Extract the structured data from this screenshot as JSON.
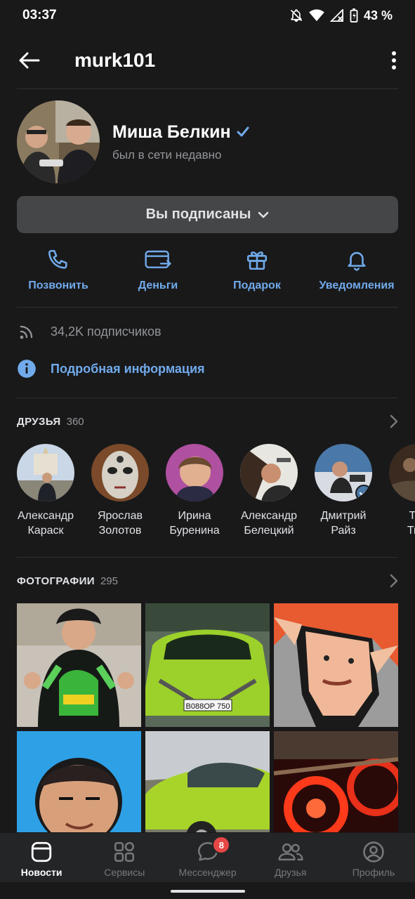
{
  "status_bar": {
    "time": "03:37",
    "battery": "43 %"
  },
  "header": {
    "title": "murk101"
  },
  "profile": {
    "name": "Миша Белкин",
    "status": "был в сети недавно",
    "subscribe_label": "Вы подписаны"
  },
  "actions": [
    {
      "label": "Позвонить",
      "icon": "phone-icon"
    },
    {
      "label": "Деньги",
      "icon": "money-transfer-icon"
    },
    {
      "label": "Подарок",
      "icon": "gift-icon"
    },
    {
      "label": "Уведомления",
      "icon": "bell-icon"
    }
  ],
  "info": {
    "followers": "34,2K подписчиков",
    "details_link": "Подробная информация"
  },
  "friends": {
    "title": "ДРУЗЬЯ",
    "count": "360",
    "items": [
      {
        "first": "Александр",
        "last": "Караск"
      },
      {
        "first": "Ярослав",
        "last": "Золотов"
      },
      {
        "first": "Ирина",
        "last": "Буренина"
      },
      {
        "first": "Александр",
        "last": "Белецкий"
      },
      {
        "first": "Дмитрий",
        "last": "Райз"
      },
      {
        "first": "Тат",
        "last": "Тюц"
      }
    ]
  },
  "photos": {
    "title": "ФОТОГРАФИИ",
    "count": "295",
    "plate_text": "В088ОР 750"
  },
  "bottom_nav": [
    {
      "label": "Новости",
      "icon": "news-icon",
      "active": true
    },
    {
      "label": "Сервисы",
      "icon": "services-icon",
      "active": false
    },
    {
      "label": "Мессенджер",
      "icon": "messenger-icon",
      "active": false,
      "badge": "8"
    },
    {
      "label": "Друзья",
      "icon": "friends-icon",
      "active": false
    },
    {
      "label": "Профиль",
      "icon": "profile-icon",
      "active": false
    }
  ],
  "colors": {
    "accent": "#71aaeb",
    "background": "#19191a",
    "badge": "#e64646"
  }
}
